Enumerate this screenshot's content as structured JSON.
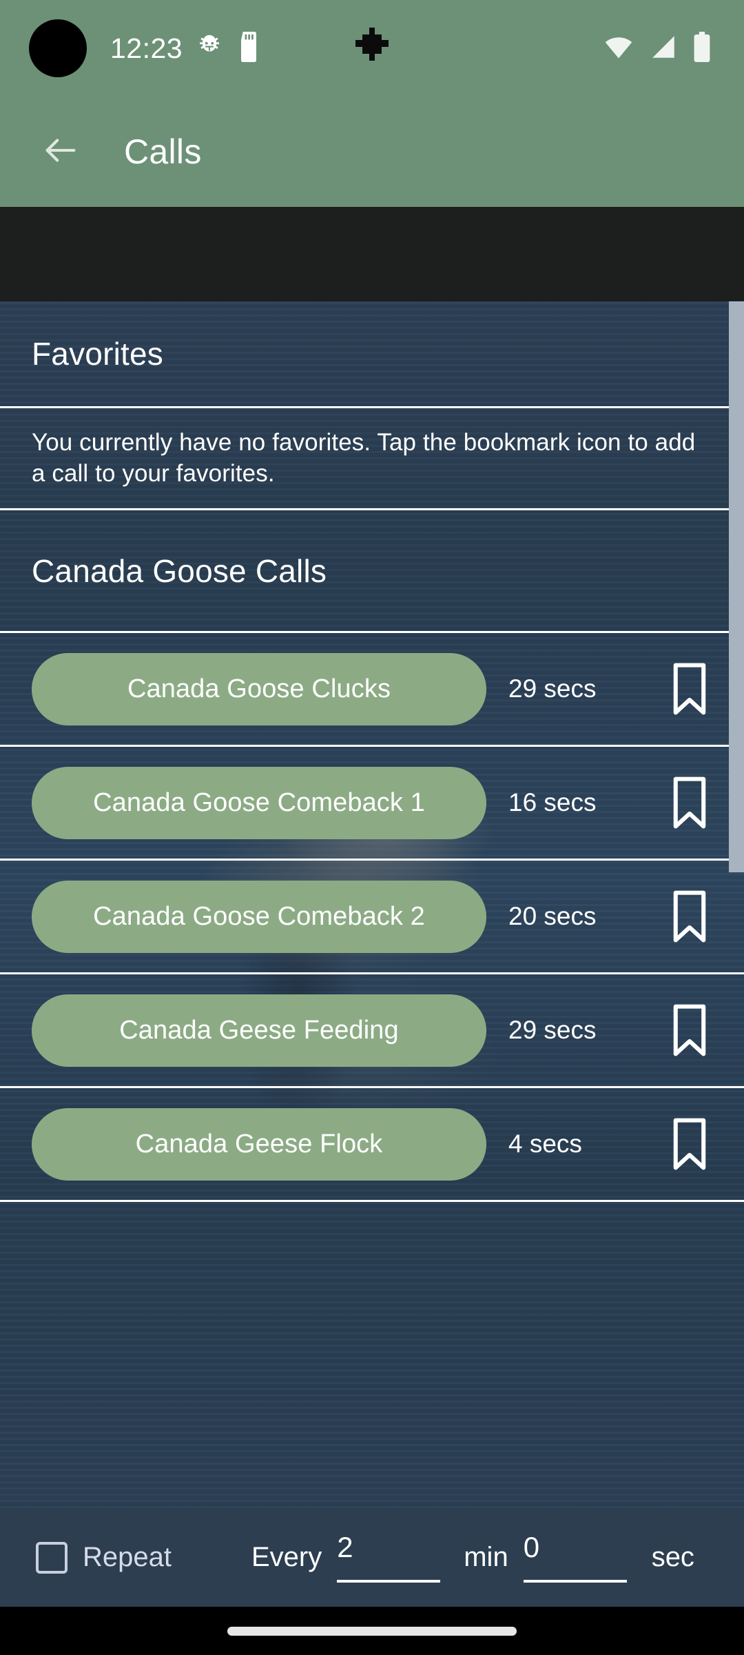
{
  "status_bar": {
    "clock": "12:23",
    "icons": [
      "bug-icon",
      "sd-card-icon"
    ],
    "right_icons": [
      "wifi-icon",
      "cellular-signal-icon",
      "battery-icon"
    ],
    "background_color": "#6d9177"
  },
  "app_bar": {
    "back_icon": "back-arrow-icon",
    "title": "Calls",
    "background_color": "#6d9177"
  },
  "content": {
    "background_color": "#2f4459",
    "favorites": {
      "title": "Favorites",
      "empty_message": "You currently have no favorites. Tap the bookmark icon to add a call to your favorites."
    },
    "calls_section": {
      "title": "Canada Goose Calls",
      "items": [
        {
          "name": "Canada Goose Clucks",
          "duration": "29 secs",
          "bookmark_icon": "bookmark-outline-icon",
          "bookmarked": false
        },
        {
          "name": "Canada Goose Comeback 1",
          "duration": "16 secs",
          "bookmark_icon": "bookmark-outline-icon",
          "bookmarked": false
        },
        {
          "name": "Canada Goose Comeback 2",
          "duration": "20 secs",
          "bookmark_icon": "bookmark-outline-icon",
          "bookmarked": false
        },
        {
          "name": "Canada Geese Feeding",
          "duration": "29 secs",
          "bookmark_icon": "bookmark-outline-icon",
          "bookmarked": false
        },
        {
          "name": "Canada Geese Flock",
          "duration": "4 secs",
          "bookmark_icon": "bookmark-outline-icon",
          "bookmarked": false
        }
      ]
    },
    "pill_color": "#8cab85"
  },
  "bottom_bar": {
    "repeat_label": "Repeat",
    "repeat_checked": false,
    "every_label": "Every",
    "minutes_value": "2",
    "minutes_unit": "min",
    "seconds_value": "0",
    "seconds_unit": "sec",
    "background_color": "#2c3e50"
  },
  "nav_bar": {
    "handle": "gesture-handle"
  }
}
